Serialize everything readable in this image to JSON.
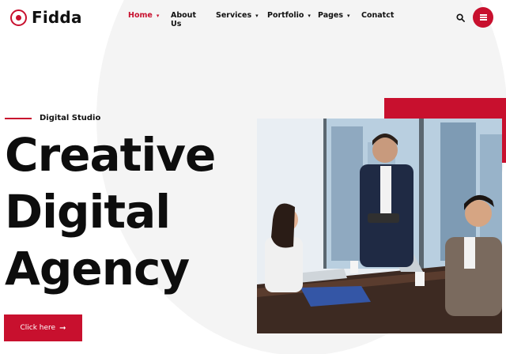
{
  "brand": {
    "name": "Fidda",
    "accent": "#c8102e"
  },
  "nav": {
    "items": [
      {
        "label": "Home",
        "caret": "▾",
        "active": true
      },
      {
        "label": "About Us",
        "caret": "",
        "active": false
      },
      {
        "label": "Services",
        "caret": "▾",
        "active": false
      },
      {
        "label": "Portfolio",
        "caret": "▾",
        "active": false
      },
      {
        "label": "Pages",
        "caret": "▾",
        "active": false
      },
      {
        "label": "Conatct",
        "caret": "",
        "active": false
      }
    ]
  },
  "actions": {
    "search_icon": "search-icon",
    "menu_icon": "hamburger-icon"
  },
  "hero": {
    "eyebrow": "Digital Studio",
    "headline": [
      "Creative",
      "Digital",
      "Agency"
    ],
    "cta_label": "Click here",
    "cta_arrow": "➞"
  },
  "image": {
    "description_icon": "team-meeting-photo"
  }
}
